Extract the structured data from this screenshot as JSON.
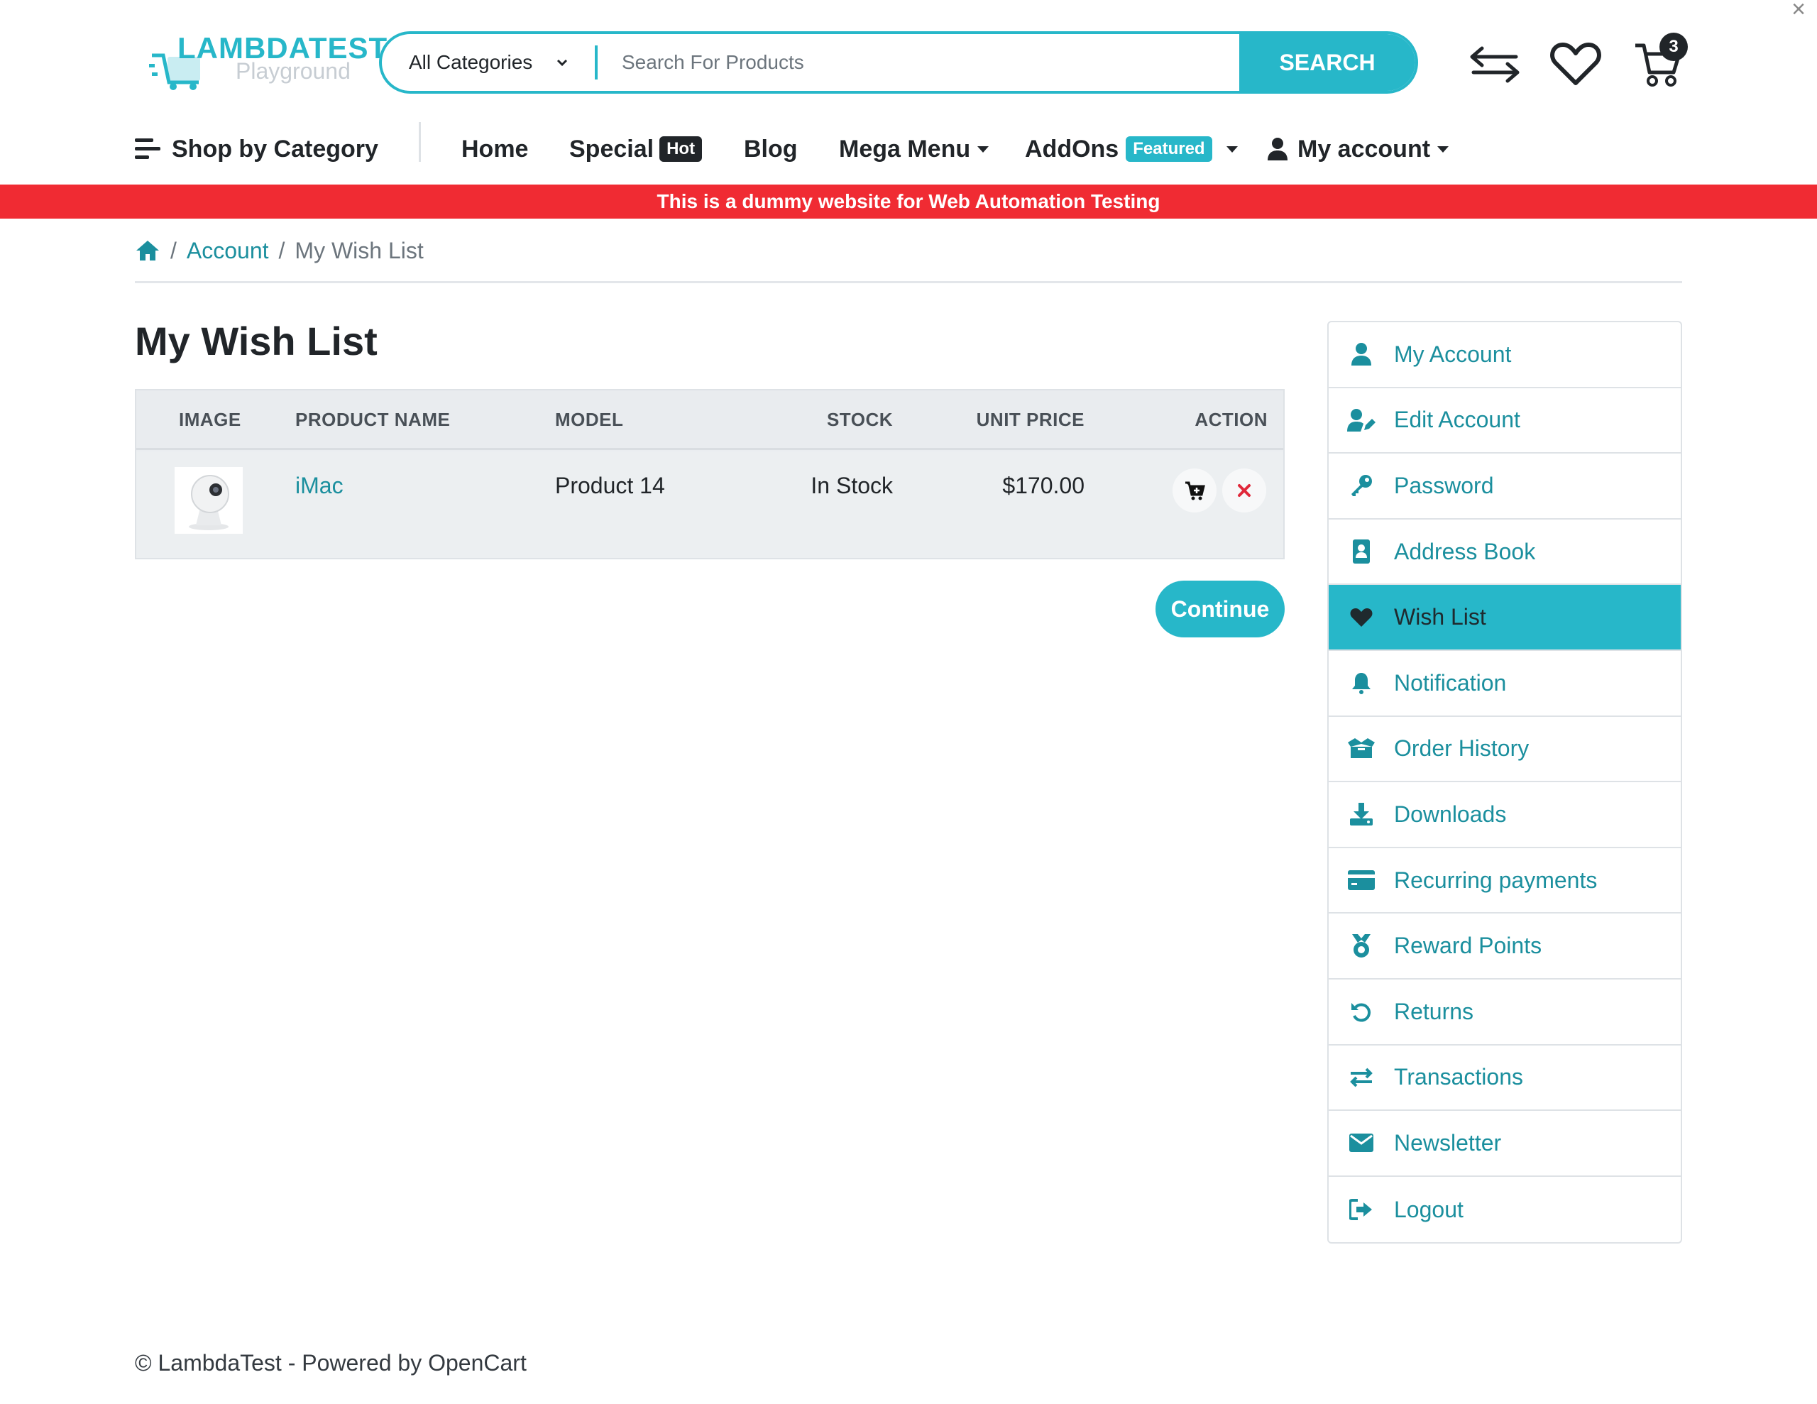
{
  "brand": {
    "logo_text": "LAMBDATEST",
    "logo_sub": "Playground",
    "accent": "#27b7c9",
    "link": "#1b8f9e",
    "promo_bg": "#f02b33"
  },
  "search": {
    "category": "All Categories",
    "placeholder": "Search For Products",
    "button": "SEARCH"
  },
  "header_icons": {
    "compare": "compare-arrows-icon",
    "wishlist": "heart-icon",
    "cart": "cart-icon",
    "cart_count": "3"
  },
  "nav": {
    "shop_by_category": "Shop by Category",
    "home": "Home",
    "special": "Special",
    "special_badge": "Hot",
    "blog": "Blog",
    "mega_menu": "Mega Menu",
    "addons": "AddOns",
    "addons_badge": "Featured",
    "my_account": "My account"
  },
  "promo": "This is a dummy website for Web Automation Testing",
  "breadcrumb": {
    "account": "Account",
    "current": "My Wish List"
  },
  "page_title": "My Wish List",
  "table": {
    "headers": [
      "IMAGE",
      "PRODUCT NAME",
      "MODEL",
      "STOCK",
      "UNIT PRICE",
      "ACTION"
    ],
    "rows": [
      {
        "product": "iMac",
        "model": "Product 14",
        "stock": "In Stock",
        "price": "$170.00"
      }
    ]
  },
  "continue": "Continue",
  "sidebar": {
    "items": [
      {
        "label": "My Account",
        "icon": "user-icon"
      },
      {
        "label": "Edit Account",
        "icon": "user-edit-icon"
      },
      {
        "label": "Password",
        "icon": "key-icon"
      },
      {
        "label": "Address Book",
        "icon": "address-book-icon"
      },
      {
        "label": "Wish List",
        "icon": "heart-icon",
        "active": true
      },
      {
        "label": "Notification",
        "icon": "bell-icon"
      },
      {
        "label": "Order History",
        "icon": "box-open-icon"
      },
      {
        "label": "Downloads",
        "icon": "download-icon"
      },
      {
        "label": "Recurring payments",
        "icon": "credit-card-icon"
      },
      {
        "label": "Reward Points",
        "icon": "medal-icon"
      },
      {
        "label": "Returns",
        "icon": "undo-icon"
      },
      {
        "label": "Transactions",
        "icon": "exchange-icon"
      },
      {
        "label": "Newsletter",
        "icon": "envelope-icon"
      },
      {
        "label": "Logout",
        "icon": "sign-out-icon"
      }
    ]
  },
  "footer": "© LambdaTest - Powered by OpenCart"
}
